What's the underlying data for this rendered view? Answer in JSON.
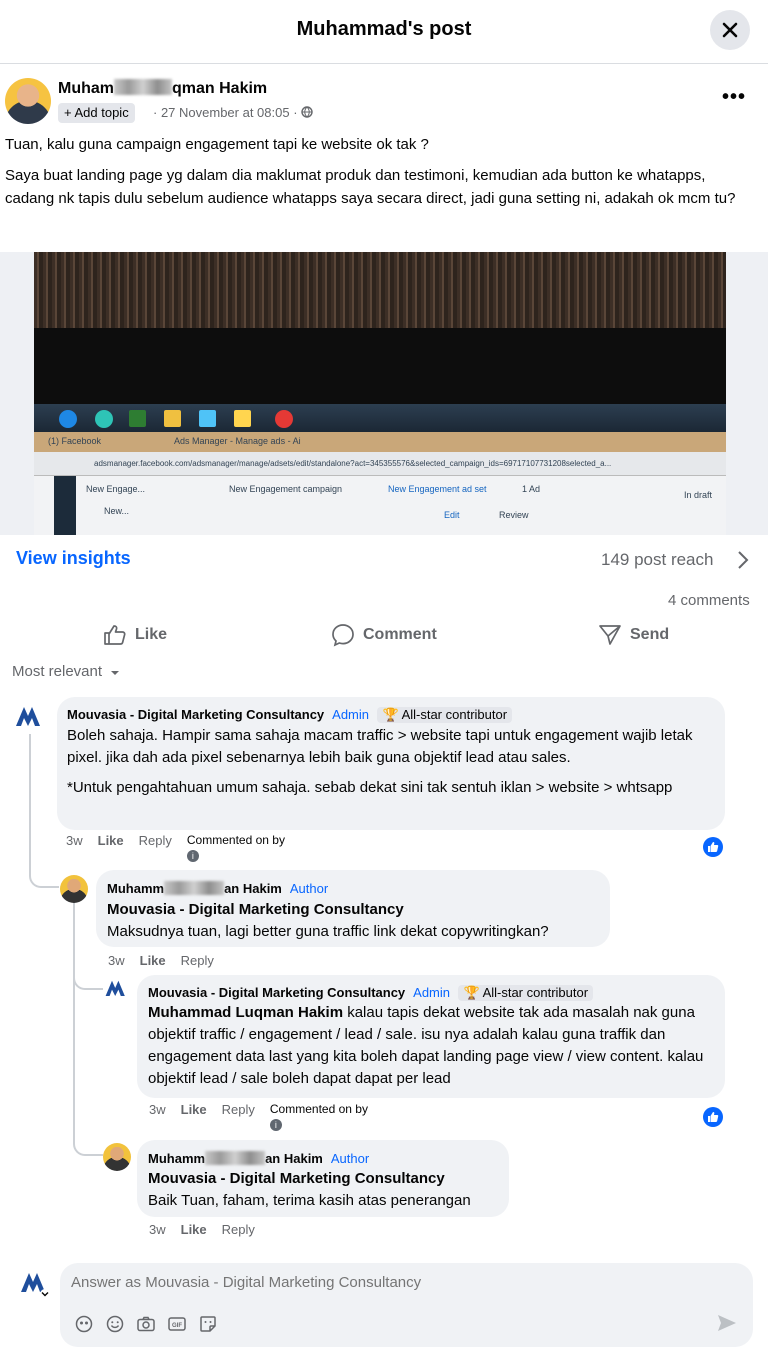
{
  "header": {
    "title": "Muhammad's post"
  },
  "post": {
    "author_prefix": "Muham",
    "author_suffix": "qman Hakim",
    "add_topic": "+ Add topic",
    "meta": "· 27 November at 08:05 ·",
    "text_line1": "Tuan, kalu guna campaign engagement tapi ke website ok tak ?",
    "text_para2": "Saya buat landing page yg dalam dia maklumat produk dan testimoni, kemudian ada button ke whatapps, cadang nk tapis dulu sebelum audience whatapps saya secara direct, jadi guna setting ni, adakah ok mcm tu?"
  },
  "photo": {
    "tab1": "(1) Facebook",
    "tab2": "Ads Manager - Manage ads - Ai",
    "url": "adsmanager.facebook.com/adsmanager/manage/adsets/edit/standalone?act=345355576&selected_campaign_ids=69717107731208selected_a...",
    "crumb1": "New Engage...",
    "crumb2": "New Engagement campaign",
    "crumb3": "New Engagement ad set",
    "crumb4": "1 Ad",
    "crumb5": "In draft",
    "crumb6": "New...",
    "edit": "Edit",
    "review": "Review"
  },
  "stats": {
    "insights": "View insights",
    "reach": "149 post reach",
    "comments_count": "4 comments"
  },
  "actions": {
    "like": "Like",
    "comment": "Comment",
    "send": "Send"
  },
  "filter": {
    "label": "Most relevant"
  },
  "comments": [
    {
      "name": "Mouvasia - Digital Marketing Consultancy",
      "role": "Admin",
      "badge": "All-star contributor",
      "text1": "Boleh sahaja. Hampir sama sahaja macam traffic > website tapi untuk engagement wajib letak pixel. jika dah ada pixel sebenarnya lebih baik guna objektif lead atau sales.",
      "text2": "*Untuk pengahtahuan umum sahaja. sebab dekat sini tak sentuh iklan > website > whtsapp",
      "time": "3w",
      "like": "Like",
      "reply": "Reply",
      "commented_on_by": "Commented on by"
    },
    {
      "name_prefix": "Muhamm",
      "name_suffix": "an Hakim",
      "role": "Author",
      "tag": "Mouvasia - Digital Marketing Consultancy",
      "text": "Maksudnya tuan, lagi better guna traffic link dekat copywritingkan?",
      "time": "3w",
      "like": "Like",
      "reply": "Reply"
    },
    {
      "name": "Mouvasia - Digital Marketing Consultancy",
      "role": "Admin",
      "badge": "All-star contributor",
      "tag": "Muhammad Luqman Hakim",
      "text": "kalau tapis dekat website tak ada masalah nak guna objektif traffic / engagement / lead / sale. isu nya adalah kalau guna traffik dan engagement data last yang kita boleh dapat landing page view / view content. kalau objektif lead / sale boleh dapat dapat per lead",
      "time": "3w",
      "like": "Like",
      "reply": "Reply",
      "commented_on_by": "Commented on by"
    },
    {
      "name_prefix": "Muhamm",
      "name_suffix": "an Hakim",
      "role": "Author",
      "tag": "Mouvasia - Digital Marketing Consultancy",
      "text": "Baik Tuan, faham, terima kasih atas penerangan",
      "time": "3w",
      "like": "Like",
      "reply": "Reply"
    }
  ],
  "composer": {
    "placeholder": "Answer as Mouvasia - Digital Marketing Consultancy"
  },
  "colors": {
    "accent": "#0866ff",
    "bubble": "#f0f2f5",
    "muted": "#65676b"
  }
}
